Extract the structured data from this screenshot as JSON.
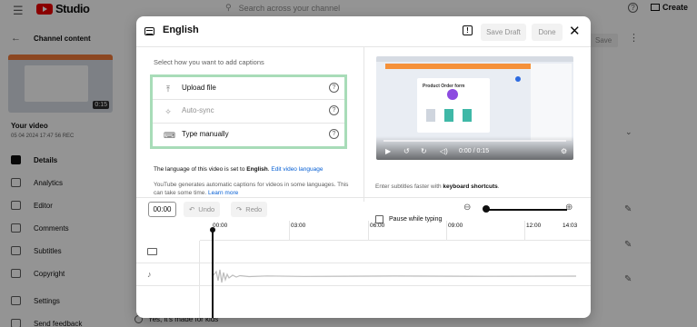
{
  "studio": {
    "logo_text": "Studio",
    "search_placeholder": "Search across your channel",
    "create_label": "Create"
  },
  "sidebar": {
    "back_label": "Channel content",
    "thumbnail_duration": "0:15",
    "your_video": "Your video",
    "video_date": "05 04 2024 17:47 56 REC",
    "items": [
      {
        "label": "Details",
        "icon": "pencil-icon",
        "active": true
      },
      {
        "label": "Analytics",
        "icon": "analytics-icon"
      },
      {
        "label": "Editor",
        "icon": "editor-icon"
      },
      {
        "label": "Comments",
        "icon": "comments-icon"
      },
      {
        "label": "Subtitles",
        "icon": "subtitles-icon"
      },
      {
        "label": "Copyright",
        "icon": "copyright-icon"
      },
      {
        "label": "Settings",
        "icon": "settings-icon"
      },
      {
        "label": "Send feedback",
        "icon": "feedback-icon"
      }
    ]
  },
  "background": {
    "save_label": "Save",
    "kids_option": "Yes, it's made for kids"
  },
  "dialog": {
    "title": "English",
    "save_draft": "Save Draft",
    "done": "Done",
    "select_label": "Select how you want to add captions",
    "options": [
      {
        "label": "Upload file",
        "icon": "upload-icon",
        "disabled": false
      },
      {
        "label": "Auto-sync",
        "icon": "autosync-icon",
        "disabled": true
      },
      {
        "label": "Type manually",
        "icon": "keyboard-icon",
        "disabled": false
      }
    ],
    "lang_note_prefix": "The language of this video is set to ",
    "lang_note_lang": "English",
    "lang_note_link": "Edit video language",
    "auto_note": "YouTube generates automatic captions for videos in some languages. This can take some time.",
    "learn_more": "Learn more",
    "player": {
      "time": "0:00 / 0:15",
      "card_title": "Product Order form"
    },
    "shortcuts_prefix": "Enter subtitles faster with ",
    "shortcuts_bold": "keyboard shortcuts",
    "pause_label": "Pause while typing",
    "timeline": {
      "time_value": "00:00",
      "undo": "Undo",
      "redo": "Redo",
      "ticks": [
        "00:00",
        "03:00",
        "06:00",
        "09:00",
        "12:00",
        "14:03"
      ]
    }
  },
  "colors": {
    "highlight_border": "#a8dcb8",
    "link": "#065fd4",
    "brand_red": "#ee0000"
  }
}
